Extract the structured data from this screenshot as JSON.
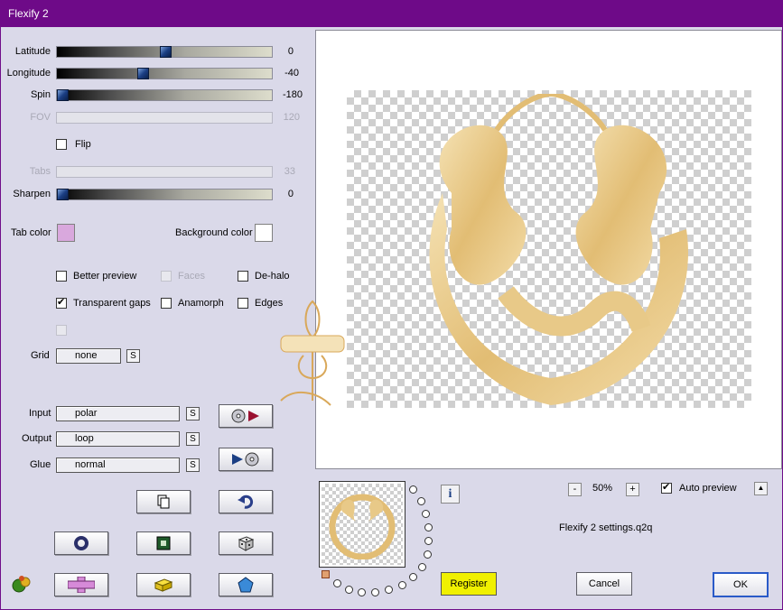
{
  "window": {
    "title": "Flexify 2"
  },
  "sliders": [
    {
      "label": "Latitude",
      "value": "0",
      "enabled": true,
      "position": 0.5
    },
    {
      "label": "Longitude",
      "value": "-40",
      "enabled": true,
      "position": 0.39
    },
    {
      "label": "Spin",
      "value": "-180",
      "enabled": true,
      "position": 0.0
    },
    {
      "label": "FOV",
      "value": "120",
      "enabled": false
    },
    {
      "label": "Tabs",
      "value": "33",
      "enabled": false
    },
    {
      "label": "Sharpen",
      "value": "0",
      "enabled": true,
      "position": 0.0
    }
  ],
  "flip": {
    "label": "Flip",
    "checked": false
  },
  "tab_color": {
    "label": "Tab color",
    "color": "#d9a8dd"
  },
  "background_color": {
    "label": "Background color",
    "color": "#ffffff"
  },
  "options": {
    "better_preview": {
      "label": "Better preview",
      "checked": false
    },
    "faces": {
      "label": "Faces",
      "checked": false,
      "enabled": false
    },
    "dehalo": {
      "label": "De-halo",
      "checked": false
    },
    "transparent_gaps": {
      "label": "Transparent gaps",
      "checked": true
    },
    "anamorph": {
      "label": "Anamorph",
      "checked": false
    },
    "edges": {
      "label": "Edges",
      "checked": false
    }
  },
  "grid": {
    "label": "Grid",
    "value": "none"
  },
  "input": {
    "label": "Input",
    "value": "polar"
  },
  "output": {
    "label": "Output",
    "value": "loop"
  },
  "glue": {
    "label": "Glue",
    "value": "normal"
  },
  "s_label": "S",
  "zoom": {
    "minus": "-",
    "value": "50%",
    "plus": "+"
  },
  "auto_preview": {
    "label": "Auto preview",
    "checked": true
  },
  "settings_file": "Flexify 2 settings.q2q",
  "info_label": "i",
  "buttons": {
    "register": "Register",
    "cancel": "Cancel",
    "ok": "OK"
  },
  "up_arrow": "▲",
  "colors": {
    "title_bar": "#6e0a88",
    "client_bg": "#dad9e9",
    "register_bg": "#f0f000",
    "gold": "#e6c98a"
  }
}
